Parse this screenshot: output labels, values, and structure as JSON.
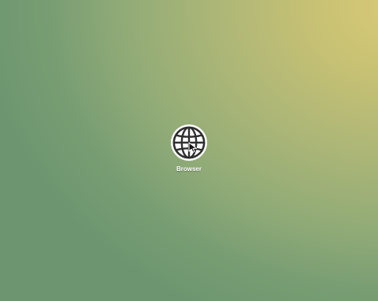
{
  "desktop": {
    "background_colors": [
      "#d7c977",
      "#c9c274",
      "#aeb777",
      "#91ab77",
      "#789d73",
      "#6d9670"
    ],
    "icons": [
      {
        "label": "Browser",
        "icon": "globe-icon"
      }
    ]
  },
  "pointer": {
    "icon": "mouse-pointer-icon"
  }
}
